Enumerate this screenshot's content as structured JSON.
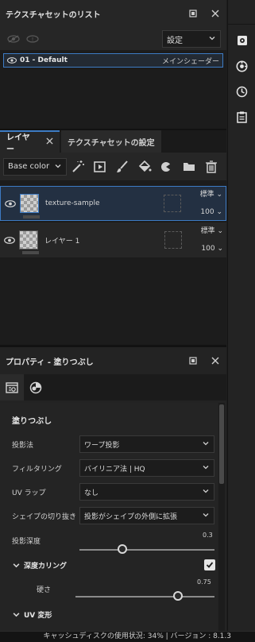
{
  "texture_set_list": {
    "title": "テクスチャセットのリスト",
    "settings_select": "設定",
    "items": [
      {
        "name": "01 - Default",
        "shader": "メインシェーダー"
      }
    ]
  },
  "layers_panel": {
    "tabs": [
      {
        "label": "レイヤー"
      },
      {
        "label": "テクスチャセットの設定"
      }
    ],
    "channel_select": "Base color",
    "layers": [
      {
        "name": "texture-sample",
        "blend_mode": "標準",
        "opacity": "100"
      },
      {
        "name": "レイヤー 1",
        "blend_mode": "標準",
        "opacity": "100"
      }
    ]
  },
  "properties_panel": {
    "title": "プロパティ - 塗りつぶし",
    "section_title": "塗りつぶし",
    "rows": [
      {
        "label": "投影法",
        "value": "ワープ投影"
      },
      {
        "label": "フィルタリング",
        "value": "バイリニア法 | HQ"
      },
      {
        "label": "UV ラップ",
        "value": "なし"
      },
      {
        "label": "シェイプの切り抜き",
        "value": "投影がシェイプの外側に拡張"
      }
    ],
    "projection_depth": {
      "label": "投影深度",
      "value": "0.3"
    },
    "depth_culling": {
      "label": "深度カリング",
      "checked": true
    },
    "hardness": {
      "label": "硬さ",
      "value": "0.75"
    },
    "uv_transform_label": "UV 変形"
  },
  "status_bar": {
    "text": "キャッシュディスクの使用状況:   34% | バージョン : 8.1.3"
  },
  "colors": {
    "accent": "#3d7bc4",
    "panel": "#262626",
    "background": "#1c1c1c"
  }
}
